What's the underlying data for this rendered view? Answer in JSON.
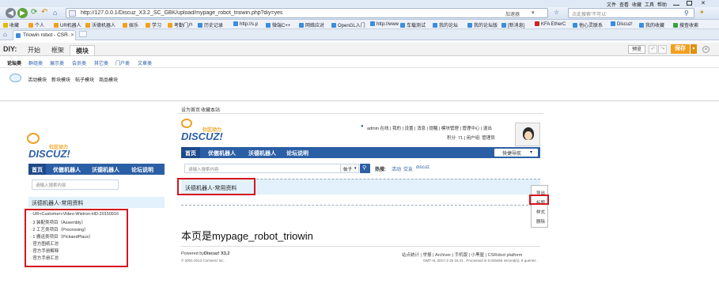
{
  "browser": {
    "menu": [
      "文件",
      "查看",
      "收藏",
      "工具",
      "帮助"
    ],
    "url": "http://127.0.0.1/Discuz_X3.2_SC_GBK/upload/mypage_robot_triowin.php?diy=yes",
    "accelerate": "加速器",
    "search_placeholder": "点此搜索'不可以'",
    "bookmarks": [
      "收藏",
      "个人",
      "UR机器人",
      "沃德机器人",
      "娱乐",
      "学习",
      "考勤门户",
      "历史记录",
      "http://s.p",
      "微端C++",
      "网络应对",
      "OpenGL入门",
      "http://www",
      "车载测试",
      "我的论坛",
      "我的论坛版",
      "[新消息]",
      "KFA EtherC",
      "他心灵联系",
      "Discuz!",
      "我的收藏",
      "搜查收索"
    ],
    "tab_title": "Triowin robot - CSR…",
    "colors": {
      "chrome": "#dfe9f5",
      "nav_blue": "#2b5fa5",
      "highlight": "#d6141c",
      "save": "#f0a020"
    }
  },
  "diy": {
    "label": "DIY:",
    "tabs": [
      "开始",
      "框架",
      "模块"
    ],
    "sub_tabs": [
      "论坛类",
      "群组类",
      "展示类",
      "会员类",
      "其它类",
      "门户类",
      "文章类"
    ],
    "blocks": [
      "活动模块",
      "新块模块",
      "帖子模块",
      "商品模块"
    ],
    "preview": "预览",
    "save": "保存"
  },
  "top_links": [
    "设为首页",
    "收藏本站"
  ],
  "left": {
    "logo_main": "DISCUZ!",
    "logo_sub": "社区动力",
    "nav": [
      "首页",
      "优傲机器人",
      "沃德机器人",
      "论坛说明"
    ],
    "search_placeholder": "请输入搜索内容",
    "strip_title": "沃德机器人-常用资料",
    "items": [
      "UR+Customer+Video-Wistron-HD-20150916",
      "3 装配类项目（Assembly）",
      "2 工艺类项目（Processing）",
      "1 搬运类项目（PickandPlace）",
      "官方图纸汇总",
      "官方手册解释",
      "官方手册汇总"
    ]
  },
  "right": {
    "logo_main": "DISCUZ!",
    "logo_sub": "社区动力",
    "user_line": "admin 在线 | 我的 | 设置 | 消息 | 提醒 | 模块管理 | 管理中心 | 退出",
    "credit_line": "积分: 71 | 用户组: 管理员",
    "nav": [
      "首页",
      "优傲机器人",
      "沃德机器人",
      "论坛说明"
    ],
    "quick_nav": "快捷导航",
    "search_placeholder": "请输入搜索内容",
    "search_cat": "帖子",
    "hot_label": "热搜:",
    "hot_words": [
      "活动",
      "交友",
      "discuz"
    ],
    "strip_title": "沃德机器人-常用资料",
    "popup": [
      "导出",
      "标题",
      "样式",
      "删除"
    ],
    "page_title": "本页是mypage_robot_triowin",
    "powered": "Powered by",
    "discuz_ver": "Discuz! X3.2",
    "copyright": "© 2001-2013 Comsenz Inc.",
    "footer_links": "站点统计 | 举报 | Archiver | 手机版 | 小黑屋 | CSRobot platform",
    "footer_meta": "GMT+8, 2017-1-25 16:41 , Processed in 0.029455 second(s), 8 queries ."
  }
}
